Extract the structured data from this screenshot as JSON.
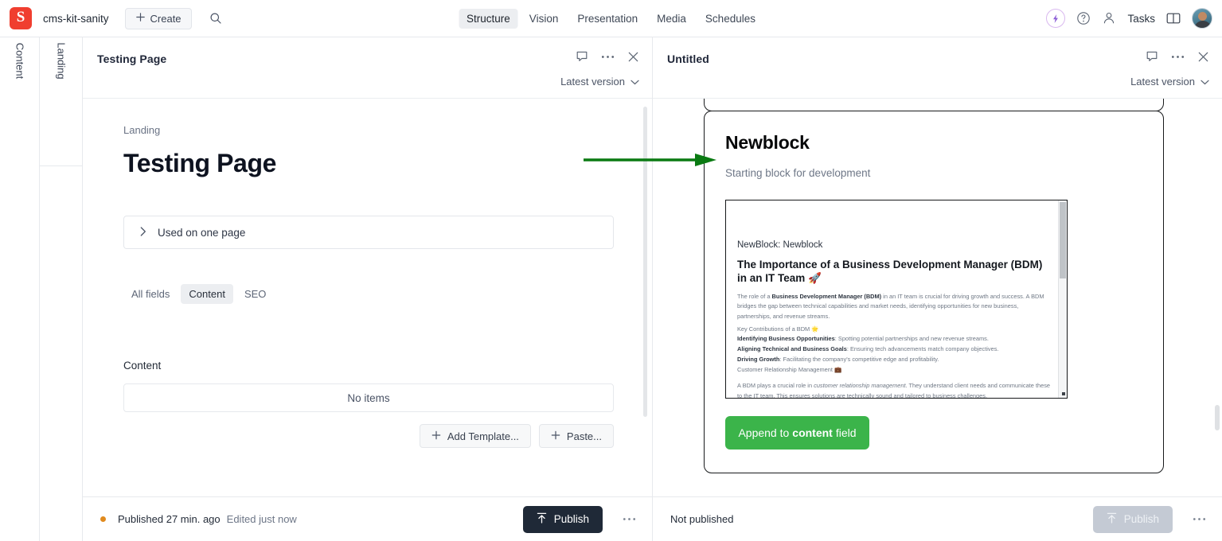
{
  "topbar": {
    "logo_letter": "S",
    "project_name": "cms-kit-sanity",
    "create_label": "Create",
    "search_icon": "search-icon",
    "nav_tabs": [
      {
        "label": "Structure",
        "active": true
      },
      {
        "label": "Vision",
        "active": false
      },
      {
        "label": "Presentation",
        "active": false
      },
      {
        "label": "Media",
        "active": false
      },
      {
        "label": "Schedules",
        "active": false
      }
    ],
    "right_icons": [
      "bolt-icon",
      "help-icon",
      "users-icon"
    ],
    "tasks_label": "Tasks",
    "panel_toggle_icon": "panel-toggle-icon",
    "avatar": "user-avatar"
  },
  "rails": [
    {
      "label": "Content"
    },
    {
      "label": "Landing"
    }
  ],
  "left_pane": {
    "header_title": "Testing Page",
    "header_icons": [
      "comment-icon",
      "more-menu-icon",
      "close-icon"
    ],
    "version_label": "Latest version",
    "breadcrumb": "Landing",
    "doc_title": "Testing Page",
    "used_on": "Used on one page",
    "field_tabs": [
      {
        "label": "All fields",
        "active": false
      },
      {
        "label": "Content",
        "active": true
      },
      {
        "label": "SEO",
        "active": false
      }
    ],
    "content_field_label": "Content",
    "no_items": "No items",
    "add_template_label": "Add Template...",
    "paste_label": "Paste...",
    "footer": {
      "status": "Published 27 min. ago",
      "status_sub": "Edited just now",
      "publish_label": "Publish"
    }
  },
  "right_pane": {
    "header_title": "Untitled",
    "header_icons": [
      "comment-icon",
      "more-menu-icon",
      "close-icon"
    ],
    "version_label": "Latest version",
    "block": {
      "title": "Newblock",
      "subtitle": "Starting block for development",
      "preview": {
        "kicker": "NewBlock: Newblock",
        "heading": "The Importance of a Business Development Manager (BDM) in an IT Team 🚀",
        "paragraph_1_pre": "The role of a ",
        "paragraph_1_bold": "Business Development Manager (BDM)",
        "paragraph_1_post": " in an IT team is crucial for driving growth and success. A BDM bridges the gap between technical capabilities and market needs, identifying opportunities for new business, partnerships, and revenue streams.",
        "section_heading": "Key Contributions of a BDM 🌟",
        "bullets": [
          {
            "bold": "Identifying Business Opportunities",
            "text": ": Spotting potential partnerships and new revenue streams."
          },
          {
            "bold": "Aligning Technical and Business Goals",
            "text": ": Ensuring tech advancements match company objectives."
          },
          {
            "bold": "Driving Growth",
            "text": ": Facilitating the company's competitive edge and profitability."
          }
        ],
        "section_heading_2": "Customer Relationship Management 💼",
        "paragraph_2_pre": "A BDM plays a crucial role in ",
        "paragraph_2_italic": "customer relationship management",
        "paragraph_2_post": ". They understand client needs and communicate these to the IT team. This ensures solutions are technically sound and tailored to business challenges."
      },
      "append_button": {
        "pre": "Append to ",
        "bold": "content",
        "post": " field"
      }
    },
    "footer": {
      "status": "Not published",
      "publish_label": "Publish"
    }
  },
  "annotation": {
    "arrow": "green-arrow-pointing-to-newblock",
    "color": "#0a7a12"
  },
  "colors": {
    "brand_red": "#f03e2f",
    "accent_green": "#3bb44a",
    "publish_dark": "#1f2937",
    "status_orange": "#e08a1e"
  }
}
